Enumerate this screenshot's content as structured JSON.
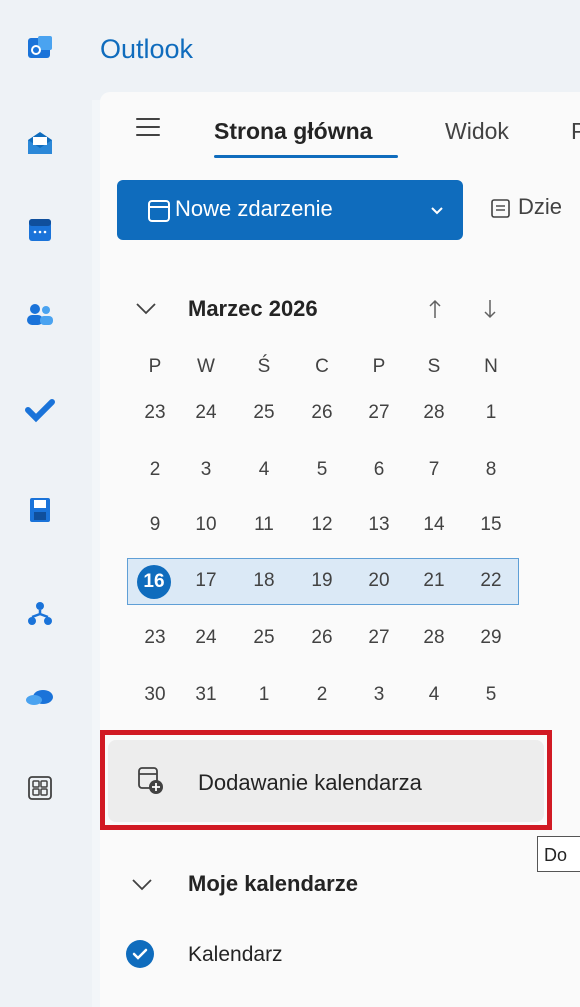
{
  "app": {
    "title": "Outlook"
  },
  "rail": {
    "icons": [
      "outlook-icon",
      "mail-icon",
      "calendar-icon",
      "people-icon",
      "todo-icon",
      "files-icon",
      "org-icon",
      "onedrive-icon",
      "apps-icon"
    ]
  },
  "ribbon": {
    "tabs": [
      "Strona główna",
      "Widok",
      "P"
    ],
    "new_event_label": "Nowe zdarzenie",
    "day_label": "Dzie"
  },
  "calendar": {
    "month_label": "Marzec 2026",
    "weekdays": [
      "P",
      "W",
      "Ś",
      "C",
      "P",
      "S",
      "N"
    ],
    "weeks": [
      [
        "23",
        "24",
        "25",
        "26",
        "27",
        "28",
        "1"
      ],
      [
        "2",
        "3",
        "4",
        "5",
        "6",
        "7",
        "8"
      ],
      [
        "9",
        "10",
        "11",
        "12",
        "13",
        "14",
        "15"
      ],
      [
        "16",
        "17",
        "18",
        "19",
        "20",
        "21",
        "22"
      ],
      [
        "23",
        "24",
        "25",
        "26",
        "27",
        "28",
        "29"
      ],
      [
        "30",
        "31",
        "1",
        "2",
        "3",
        "4",
        "5"
      ]
    ],
    "today": "16",
    "highlighted_week": 3
  },
  "add_calendar_label": "Dodawanie kalendarza",
  "tooltip_text": "Do",
  "my_calendars": {
    "section_label": "Moje kalendarze",
    "items": [
      {
        "label": "Kalendarz",
        "checked": true,
        "color": "#0f6cbd"
      }
    ]
  },
  "colors": {
    "accent": "#0f6cbd",
    "highlight_box": "#d11a24"
  }
}
